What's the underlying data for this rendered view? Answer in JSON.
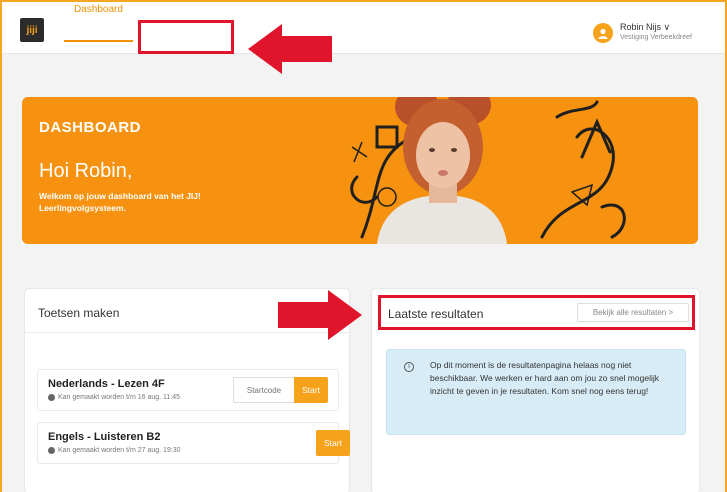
{
  "nav": {
    "logo": "jiji",
    "dashboard_tab": "Dashboard",
    "user_name": "Robin Nijs ∨",
    "user_location": "Vestiging Verbeekdreef"
  },
  "banner": {
    "title": "DASHBOARD",
    "greeting": "Hoi Robin,",
    "welcome": "Welkom op jouw dashboard van het JIJ! Leerlingvolgsysteem."
  },
  "tests_card": {
    "title": "Toetsen maken",
    "tests": [
      {
        "name": "Nederlands - Lezen 4F",
        "available": "Kan gemaakt worden t/m 16 aug. 11:45",
        "startcode_placeholder": "Startcode",
        "start_label": "Start"
      },
      {
        "name": "Engels - Luisteren B2",
        "available": "Kan gemaakt worden t/m 27 aug. 19:30",
        "start_label": "Start"
      }
    ]
  },
  "results_card": {
    "title": "Laatste resultaten",
    "view_all": "Bekijk alle resultaten >",
    "info_icon": "i",
    "info_text": "Op dit moment is de resultatenpagina helaas nog niet beschikbaar. We werken er hard aan om jou zo snel mogelijk inzicht te geven in je resultaten. Kom snel nog eens terug!"
  },
  "colors": {
    "accent": "#f39200",
    "banner": "#f6920f",
    "highlight": "#e0142b",
    "info_bg": "#d8ecf7"
  }
}
